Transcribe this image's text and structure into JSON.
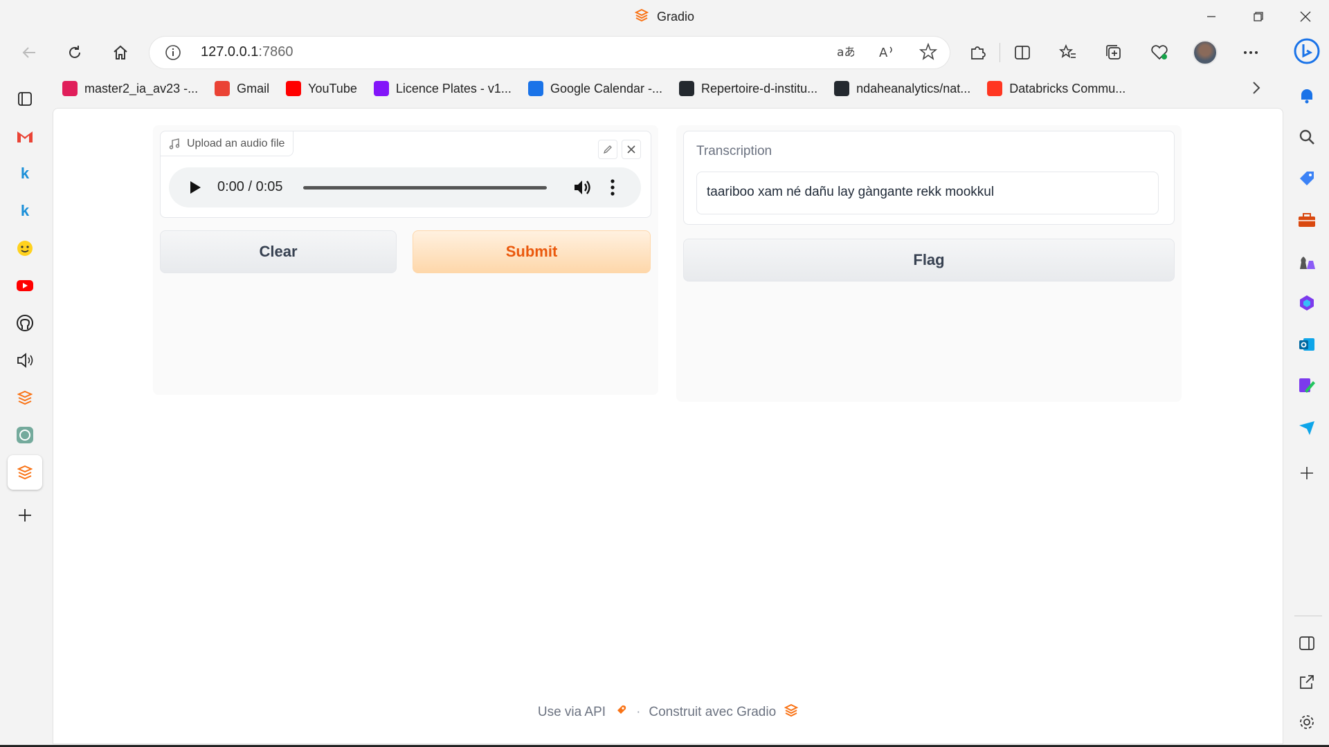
{
  "window": {
    "title": "Gradio"
  },
  "browser": {
    "url_host": "127.0.0.1",
    "url_port": ":7860"
  },
  "favorites": [
    {
      "label": "master2_ia_av23 -...",
      "icon": "slack-icon",
      "color": "#e01e5a"
    },
    {
      "label": "Gmail",
      "icon": "gmail-icon",
      "color": "#ea4335"
    },
    {
      "label": "YouTube",
      "icon": "youtube-icon",
      "color": "#ff0000"
    },
    {
      "label": "Licence Plates - v1...",
      "icon": "roboflow-icon",
      "color": "#8315f9"
    },
    {
      "label": "Google Calendar -...",
      "icon": "calendar-icon",
      "color": "#1a73e8"
    },
    {
      "label": "Repertoire-d-institu...",
      "icon": "github-icon",
      "color": "#24292f"
    },
    {
      "label": "ndaheanalytics/nat...",
      "icon": "github-icon",
      "color": "#24292f"
    },
    {
      "label": "Databricks Commu...",
      "icon": "databricks-icon",
      "color": "#ff3621"
    }
  ],
  "app": {
    "audio_label": "Upload an audio file",
    "player_time": "0:00 / 0:05",
    "player_progress": 0,
    "clear_label": "Clear",
    "submit_label": "Submit",
    "transcription_label": "Transcription",
    "transcription_value": "taariboo xam né dañu lay gàngante rekk mookkul",
    "flag_label": "Flag",
    "footer_api": "Use via API",
    "footer_sep": "·",
    "footer_built": "Construit avec Gradio"
  },
  "colors": {
    "accent": "#f97316",
    "primary_text": "#ea580c"
  }
}
